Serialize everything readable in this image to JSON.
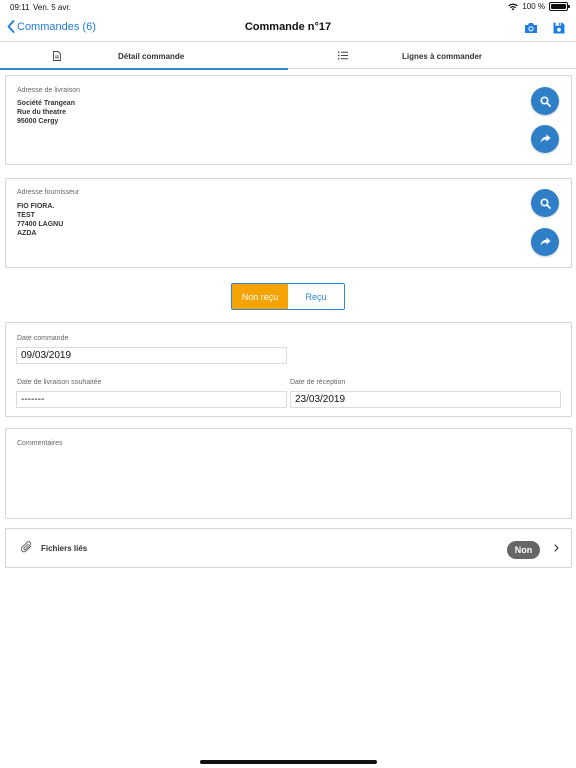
{
  "status_bar": {
    "time": "09:11",
    "date": "Ven. 5 avr.",
    "battery": "100 %"
  },
  "nav": {
    "back_label": "Commandes (6)",
    "title": "Commande n°17"
  },
  "tabs": [
    {
      "label": "Détail commande",
      "active": true
    },
    {
      "label": "Lignes à commander",
      "active": false
    }
  ],
  "delivery": {
    "label": "Adresse de livraison",
    "lines": [
      "Société Trangean",
      "Rue du theatre",
      "95000 Cergy"
    ]
  },
  "supplier": {
    "label": "Adresse fournisseur",
    "lines": [
      "FIO FIORA.",
      "TEST",
      "77400 LAGNU",
      "AZDA"
    ]
  },
  "status_toggle": {
    "not_received": "Non reçu",
    "received": "Reçu",
    "selected": "not_received"
  },
  "dates": {
    "order_label": "Date commande",
    "order_value": "09/03/2019",
    "wished_label": "Date de livraison souhaitée",
    "wished_value": "-------",
    "received_label": "Date de réception",
    "received_value": "23/03/2019"
  },
  "comments": {
    "label": "Commentaires",
    "value": ""
  },
  "files": {
    "label": "Fichiers liés",
    "badge": "Non"
  },
  "colors": {
    "accent": "#2f86d6",
    "button": "#2f7fc8",
    "toggle_on": "#f5a300",
    "badge": "#666666"
  }
}
